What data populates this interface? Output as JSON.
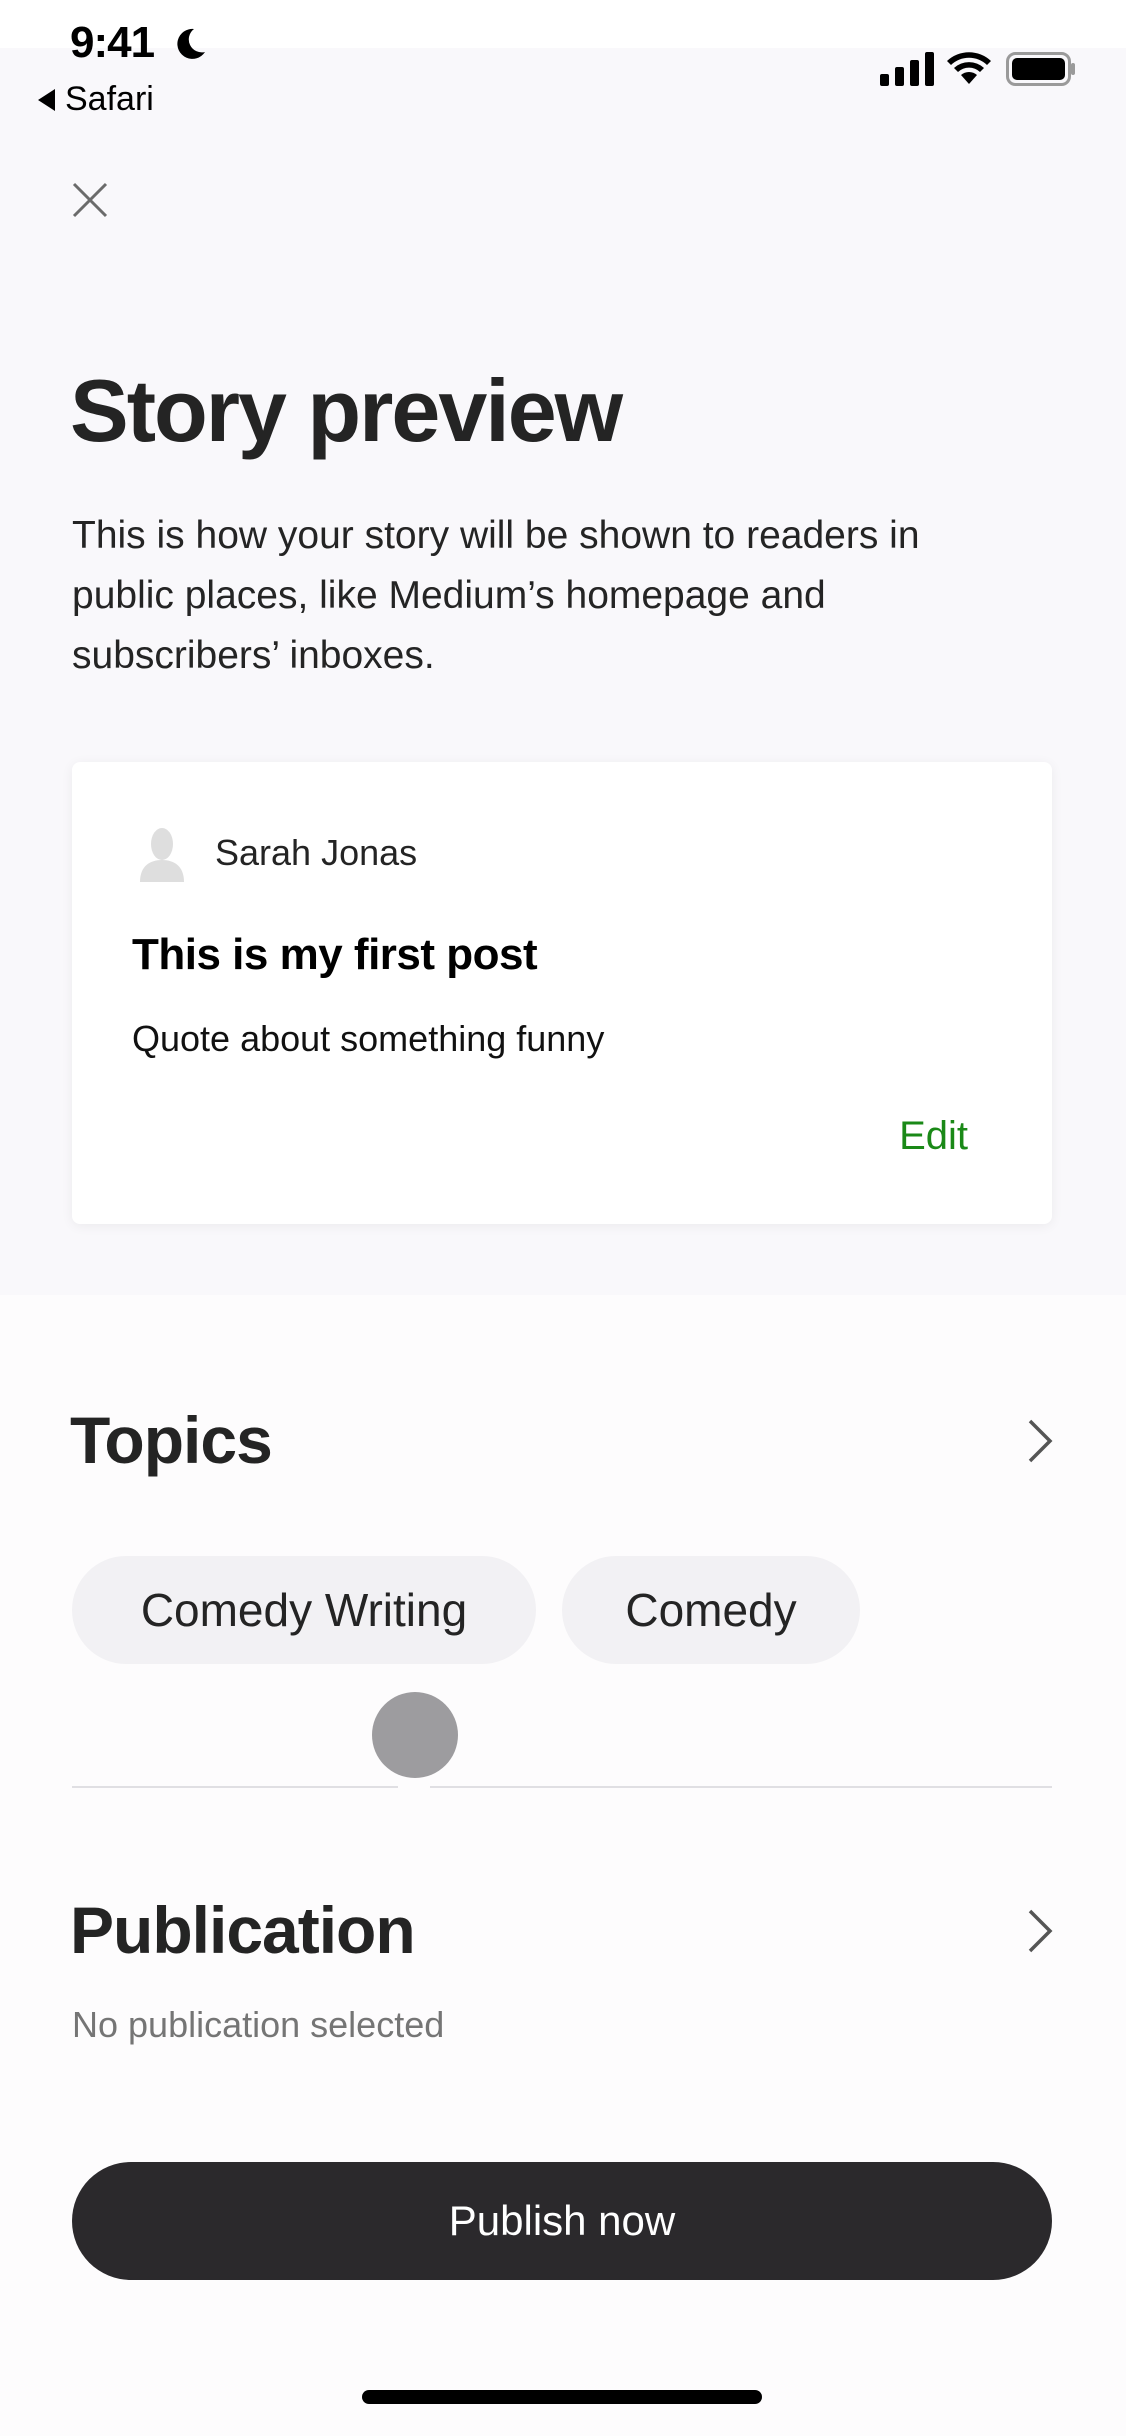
{
  "status_bar": {
    "time": "9:41",
    "back_app": "Safari",
    "icons": [
      "moon-icon",
      "cellular-signal-icon",
      "wifi-icon",
      "battery-icon"
    ]
  },
  "header": {
    "close_icon": "close-icon",
    "title": "Story preview",
    "description": "This is how your story will be shown to readers in public places, like Medium’s homepage and subscribers’ inboxes."
  },
  "preview_card": {
    "author": "Sarah Jonas",
    "post_title": "This is my first post",
    "post_subtitle": "Quote about something funny",
    "edit_label": "Edit",
    "accent_color": "#1a8917"
  },
  "topics": {
    "title": "Topics",
    "chips": [
      {
        "label": "Comedy Writing"
      },
      {
        "label": "Comedy"
      }
    ]
  },
  "publication": {
    "title": "Publication",
    "subtitle": "No publication selected"
  },
  "actions": {
    "publish_label": "Publish now"
  }
}
